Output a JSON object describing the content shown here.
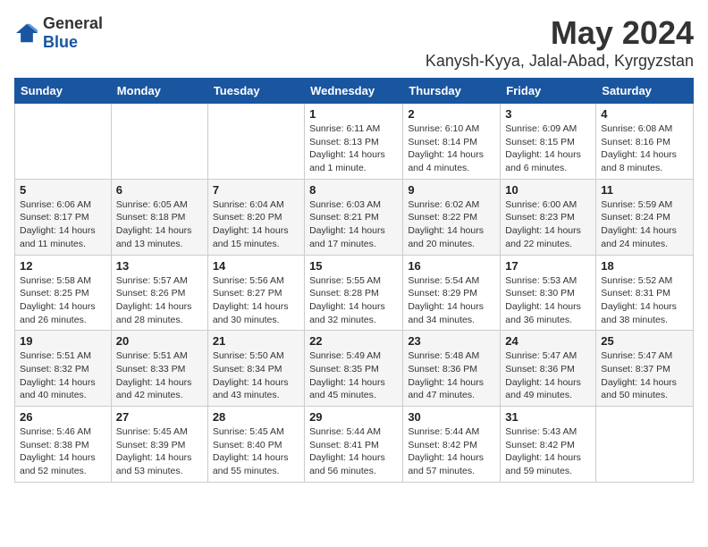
{
  "header": {
    "logo_general": "General",
    "logo_blue": "Blue",
    "month_year": "May 2024",
    "location": "Kanysh-Kyya, Jalal-Abad, Kyrgyzstan"
  },
  "days_of_week": [
    "Sunday",
    "Monday",
    "Tuesday",
    "Wednesday",
    "Thursday",
    "Friday",
    "Saturday"
  ],
  "weeks": [
    [
      {
        "day": "",
        "sunrise": "",
        "sunset": "",
        "daylight": ""
      },
      {
        "day": "",
        "sunrise": "",
        "sunset": "",
        "daylight": ""
      },
      {
        "day": "",
        "sunrise": "",
        "sunset": "",
        "daylight": ""
      },
      {
        "day": "1",
        "sunrise": "Sunrise: 6:11 AM",
        "sunset": "Sunset: 8:13 PM",
        "daylight": "Daylight: 14 hours and 1 minute."
      },
      {
        "day": "2",
        "sunrise": "Sunrise: 6:10 AM",
        "sunset": "Sunset: 8:14 PM",
        "daylight": "Daylight: 14 hours and 4 minutes."
      },
      {
        "day": "3",
        "sunrise": "Sunrise: 6:09 AM",
        "sunset": "Sunset: 8:15 PM",
        "daylight": "Daylight: 14 hours and 6 minutes."
      },
      {
        "day": "4",
        "sunrise": "Sunrise: 6:08 AM",
        "sunset": "Sunset: 8:16 PM",
        "daylight": "Daylight: 14 hours and 8 minutes."
      }
    ],
    [
      {
        "day": "5",
        "sunrise": "Sunrise: 6:06 AM",
        "sunset": "Sunset: 8:17 PM",
        "daylight": "Daylight: 14 hours and 11 minutes."
      },
      {
        "day": "6",
        "sunrise": "Sunrise: 6:05 AM",
        "sunset": "Sunset: 8:18 PM",
        "daylight": "Daylight: 14 hours and 13 minutes."
      },
      {
        "day": "7",
        "sunrise": "Sunrise: 6:04 AM",
        "sunset": "Sunset: 8:20 PM",
        "daylight": "Daylight: 14 hours and 15 minutes."
      },
      {
        "day": "8",
        "sunrise": "Sunrise: 6:03 AM",
        "sunset": "Sunset: 8:21 PM",
        "daylight": "Daylight: 14 hours and 17 minutes."
      },
      {
        "day": "9",
        "sunrise": "Sunrise: 6:02 AM",
        "sunset": "Sunset: 8:22 PM",
        "daylight": "Daylight: 14 hours and 20 minutes."
      },
      {
        "day": "10",
        "sunrise": "Sunrise: 6:00 AM",
        "sunset": "Sunset: 8:23 PM",
        "daylight": "Daylight: 14 hours and 22 minutes."
      },
      {
        "day": "11",
        "sunrise": "Sunrise: 5:59 AM",
        "sunset": "Sunset: 8:24 PM",
        "daylight": "Daylight: 14 hours and 24 minutes."
      }
    ],
    [
      {
        "day": "12",
        "sunrise": "Sunrise: 5:58 AM",
        "sunset": "Sunset: 8:25 PM",
        "daylight": "Daylight: 14 hours and 26 minutes."
      },
      {
        "day": "13",
        "sunrise": "Sunrise: 5:57 AM",
        "sunset": "Sunset: 8:26 PM",
        "daylight": "Daylight: 14 hours and 28 minutes."
      },
      {
        "day": "14",
        "sunrise": "Sunrise: 5:56 AM",
        "sunset": "Sunset: 8:27 PM",
        "daylight": "Daylight: 14 hours and 30 minutes."
      },
      {
        "day": "15",
        "sunrise": "Sunrise: 5:55 AM",
        "sunset": "Sunset: 8:28 PM",
        "daylight": "Daylight: 14 hours and 32 minutes."
      },
      {
        "day": "16",
        "sunrise": "Sunrise: 5:54 AM",
        "sunset": "Sunset: 8:29 PM",
        "daylight": "Daylight: 14 hours and 34 minutes."
      },
      {
        "day": "17",
        "sunrise": "Sunrise: 5:53 AM",
        "sunset": "Sunset: 8:30 PM",
        "daylight": "Daylight: 14 hours and 36 minutes."
      },
      {
        "day": "18",
        "sunrise": "Sunrise: 5:52 AM",
        "sunset": "Sunset: 8:31 PM",
        "daylight": "Daylight: 14 hours and 38 minutes."
      }
    ],
    [
      {
        "day": "19",
        "sunrise": "Sunrise: 5:51 AM",
        "sunset": "Sunset: 8:32 PM",
        "daylight": "Daylight: 14 hours and 40 minutes."
      },
      {
        "day": "20",
        "sunrise": "Sunrise: 5:51 AM",
        "sunset": "Sunset: 8:33 PM",
        "daylight": "Daylight: 14 hours and 42 minutes."
      },
      {
        "day": "21",
        "sunrise": "Sunrise: 5:50 AM",
        "sunset": "Sunset: 8:34 PM",
        "daylight": "Daylight: 14 hours and 43 minutes."
      },
      {
        "day": "22",
        "sunrise": "Sunrise: 5:49 AM",
        "sunset": "Sunset: 8:35 PM",
        "daylight": "Daylight: 14 hours and 45 minutes."
      },
      {
        "day": "23",
        "sunrise": "Sunrise: 5:48 AM",
        "sunset": "Sunset: 8:36 PM",
        "daylight": "Daylight: 14 hours and 47 minutes."
      },
      {
        "day": "24",
        "sunrise": "Sunrise: 5:47 AM",
        "sunset": "Sunset: 8:36 PM",
        "daylight": "Daylight: 14 hours and 49 minutes."
      },
      {
        "day": "25",
        "sunrise": "Sunrise: 5:47 AM",
        "sunset": "Sunset: 8:37 PM",
        "daylight": "Daylight: 14 hours and 50 minutes."
      }
    ],
    [
      {
        "day": "26",
        "sunrise": "Sunrise: 5:46 AM",
        "sunset": "Sunset: 8:38 PM",
        "daylight": "Daylight: 14 hours and 52 minutes."
      },
      {
        "day": "27",
        "sunrise": "Sunrise: 5:45 AM",
        "sunset": "Sunset: 8:39 PM",
        "daylight": "Daylight: 14 hours and 53 minutes."
      },
      {
        "day": "28",
        "sunrise": "Sunrise: 5:45 AM",
        "sunset": "Sunset: 8:40 PM",
        "daylight": "Daylight: 14 hours and 55 minutes."
      },
      {
        "day": "29",
        "sunrise": "Sunrise: 5:44 AM",
        "sunset": "Sunset: 8:41 PM",
        "daylight": "Daylight: 14 hours and 56 minutes."
      },
      {
        "day": "30",
        "sunrise": "Sunrise: 5:44 AM",
        "sunset": "Sunset: 8:42 PM",
        "daylight": "Daylight: 14 hours and 57 minutes."
      },
      {
        "day": "31",
        "sunrise": "Sunrise: 5:43 AM",
        "sunset": "Sunset: 8:42 PM",
        "daylight": "Daylight: 14 hours and 59 minutes."
      },
      {
        "day": "",
        "sunrise": "",
        "sunset": "",
        "daylight": ""
      }
    ]
  ]
}
